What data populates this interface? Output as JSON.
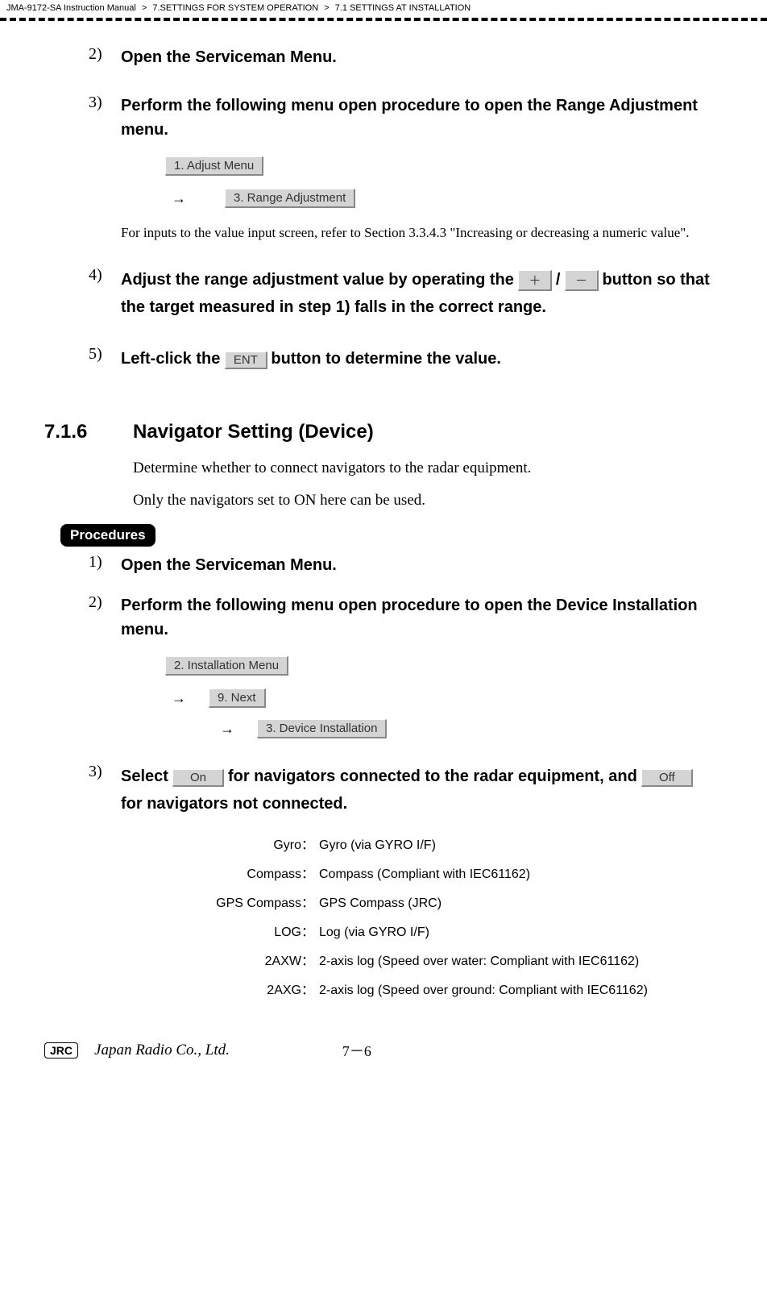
{
  "breadcrumb": {
    "part1": "JMA-9172-SA Instruction Manual",
    "sep": ">",
    "part2": "7.SETTINGS FOR SYSTEM OPERATION",
    "part3": "7.1  SETTINGS AT INSTALLATION"
  },
  "steps_a": {
    "s2": {
      "num": "2)",
      "title": "Open the Serviceman Menu."
    },
    "s3": {
      "num": "3)",
      "title": "Perform the following menu open procedure to open the Range Adjustment menu.",
      "btn1": "1. Adjust Menu",
      "arrow": "→",
      "btn2": "3. Range Adjustment",
      "note": "For inputs to the value input screen, refer to Section 3.3.4.3 \"Increasing or decreasing a numeric value\"."
    },
    "s4": {
      "num": "4)",
      "title_a": "Adjust the range adjustment value by operating the ",
      "btn_plus": "＋",
      "slash": " / ",
      "btn_minus": "－",
      "title_b": " button so that the target measured in step 1) falls in the correct range."
    },
    "s5": {
      "num": "5)",
      "title_a": "Left-click the ",
      "btn_ent": "ENT",
      "title_b": " button to determine the value."
    }
  },
  "section": {
    "num": "7.1.6",
    "title": "Navigator Setting  (Device)",
    "body1": "Determine whether to connect navigators to the radar equipment.",
    "body2": "Only the navigators set to ON here can be used."
  },
  "procedures_label": "Procedures",
  "steps_b": {
    "s1": {
      "num": "1)",
      "title": "Open the Serviceman Menu."
    },
    "s2": {
      "num": "2)",
      "title": "Perform the following menu open procedure to open the Device Installation menu.",
      "btn1": "2. Installation Menu",
      "arrow": "→",
      "btn2": "9. Next",
      "btn3": "3. Device Installation"
    },
    "s3": {
      "num": "3)",
      "title_a": "Select ",
      "btn_on": "On",
      "title_b": " for navigators connected to the radar equipment, and ",
      "btn_off": "Off",
      "title_c": " for navigators not connected."
    }
  },
  "defs": {
    "gyro": {
      "label": "Gyro：",
      "value": "Gyro (via GYRO I/F)"
    },
    "compass": {
      "label": "Compass：",
      "value": "Compass (Compliant with IEC61162)"
    },
    "gps": {
      "label": "GPS Compass：",
      "value": "GPS Compass (JRC)"
    },
    "log": {
      "label": "LOG：",
      "value": "Log (via GYRO I/F)"
    },
    "axw": {
      "label": "2AXW：",
      "value": "2-axis log (Speed over water: Compliant with IEC61162)"
    },
    "axg": {
      "label": "2AXG：",
      "value": "2-axis log (Speed over ground: Compliant with IEC61162)"
    }
  },
  "footer": {
    "jrc": "JRC",
    "company": "Japan Radio Co., Ltd.",
    "page": "7－6"
  }
}
